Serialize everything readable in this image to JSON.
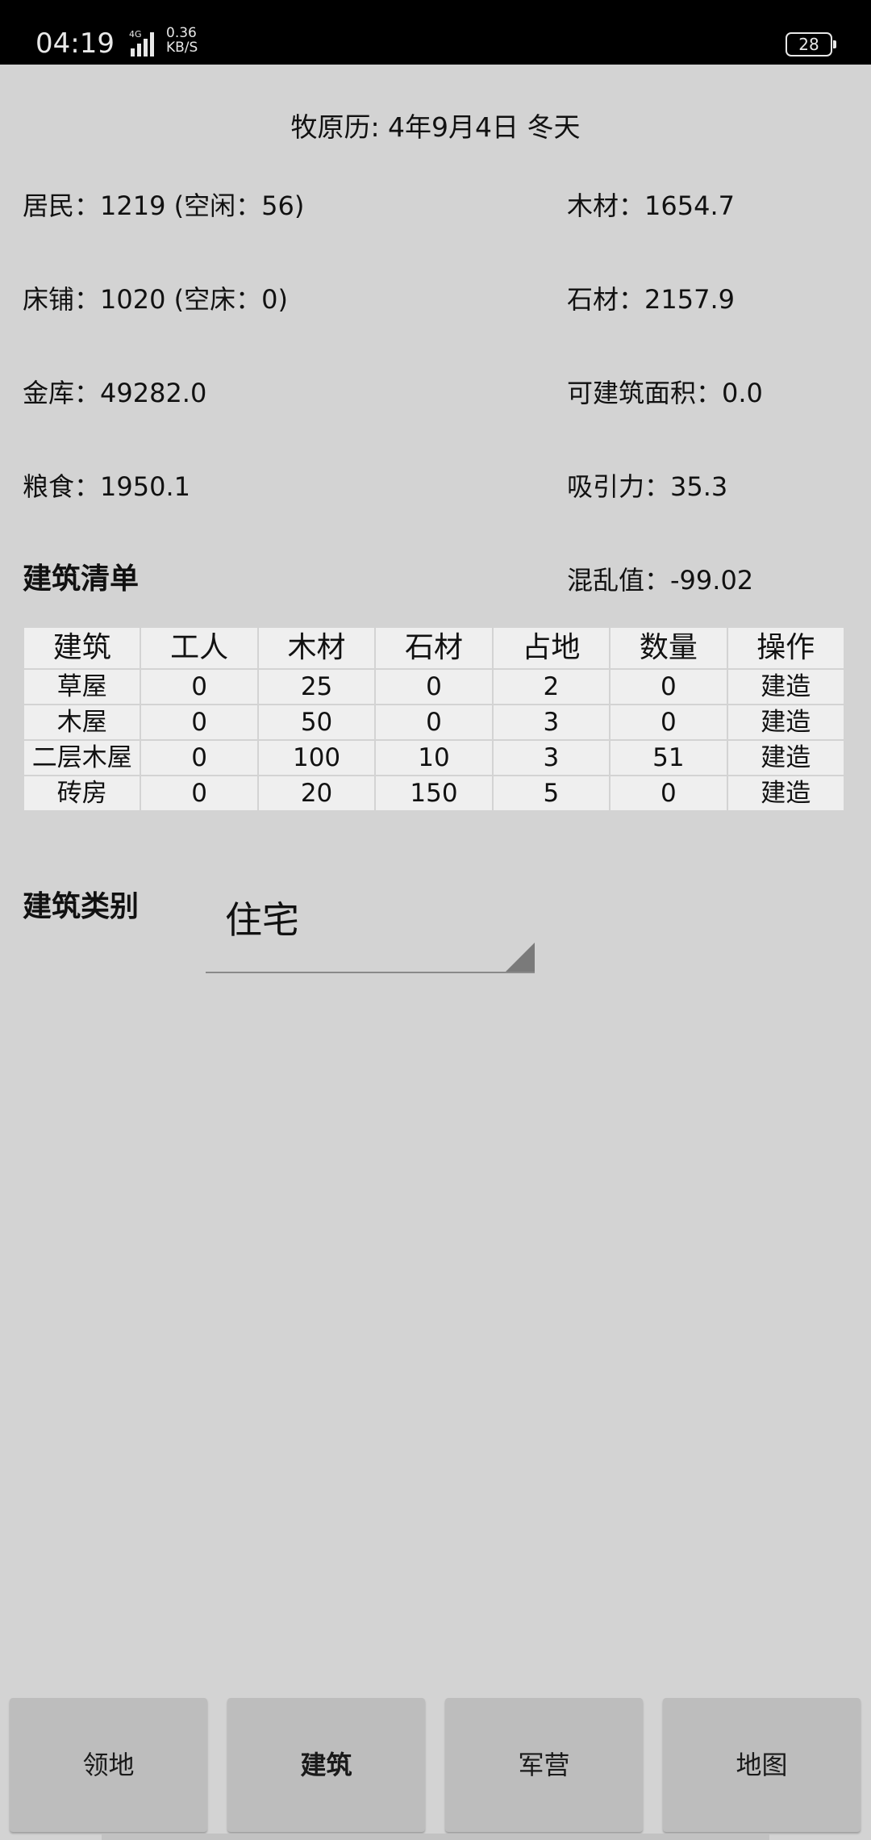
{
  "status_bar": {
    "time": "04:19",
    "network": "4G",
    "speed": "0.36",
    "speed_unit": "KB/S",
    "battery": "28"
  },
  "calendar": "牧原历: 4年9月4日  冬天",
  "stats": {
    "residents": "居民：1219 (空闲：56)",
    "beds": "床铺：1020 (空床：0)",
    "treasury": "金库：49282.0",
    "food": "粮食：1950.1",
    "wood": "木材：1654.7",
    "stone": "石材：2157.9",
    "build_area": "可建筑面积：0.0",
    "attraction": "吸引力：35.3",
    "chaos": "混乱值：-99.02"
  },
  "building_list": {
    "title": "建筑清单",
    "headers": [
      "建筑",
      "工人",
      "木材",
      "石材",
      "占地",
      "数量",
      "操作"
    ],
    "rows": [
      [
        "草屋",
        "0",
        "25",
        "0",
        "2",
        "0",
        "建造"
      ],
      [
        "木屋",
        "0",
        "50",
        "0",
        "3",
        "0",
        "建造"
      ],
      [
        "二层木屋",
        "0",
        "100",
        "10",
        "3",
        "51",
        "建造"
      ],
      [
        "砖房",
        "0",
        "20",
        "150",
        "5",
        "0",
        "建造"
      ]
    ]
  },
  "category": {
    "label": "建筑类别",
    "selected": "住宅"
  },
  "nav": {
    "items": [
      "领地",
      "建筑",
      "军营",
      "地图"
    ],
    "active": "建筑"
  }
}
